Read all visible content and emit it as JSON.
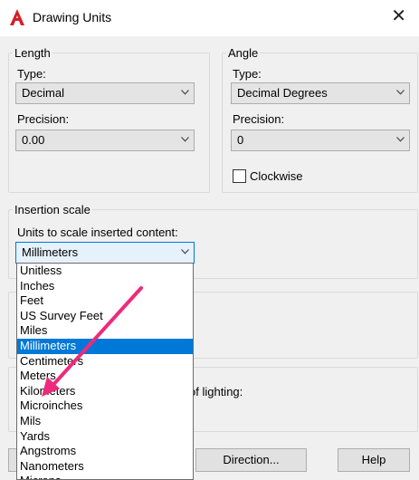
{
  "window": {
    "title": "Drawing Units",
    "close_glyph": "✕"
  },
  "length": {
    "legend": "Length",
    "type_label": "Type:",
    "type_value": "Decimal",
    "precision_label": "Precision:",
    "precision_value": "0.00"
  },
  "angle": {
    "legend": "Angle",
    "type_label": "Type:",
    "type_value": "Decimal Degrees",
    "precision_label": "Precision:",
    "precision_value": "0",
    "clockwise_label": "Clockwise",
    "clockwise_checked": false
  },
  "insertion": {
    "legend": "Insertion scale",
    "units_label": "Units to scale inserted content:",
    "units_value": "Millimeters"
  },
  "lighting": {
    "fragment": "of lighting:"
  },
  "dropdown": {
    "items": [
      "Unitless",
      "Inches",
      "Feet",
      "US Survey Feet",
      "Miles",
      "Millimeters",
      "Centimeters",
      "Meters",
      "Kilometers",
      "Microinches",
      "Mils",
      "Yards",
      "Angstroms",
      "Nanometers",
      "Microns"
    ],
    "selected": "Millimeters"
  },
  "buttons": {
    "direction": "Direction...",
    "help": "Help"
  },
  "colors": {
    "accent": "#0078d7",
    "annotation_arrow": "#ee2a7b",
    "logo": "#d42027"
  },
  "icons": [
    "autocad-logo-icon",
    "close-icon",
    "chevron-down-icon",
    "annotation-arrow-icon"
  ]
}
